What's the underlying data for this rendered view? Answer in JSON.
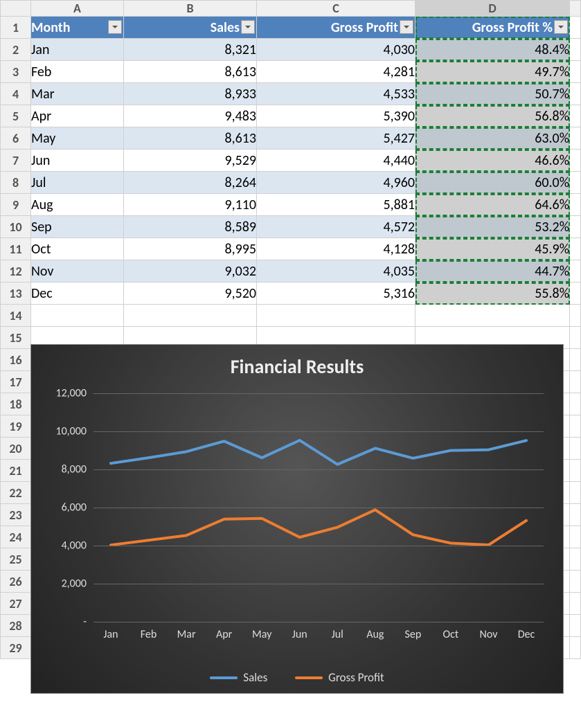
{
  "columns": [
    "A",
    "B",
    "C",
    "D"
  ],
  "headers": {
    "month": "Month",
    "sales": "Sales",
    "gross_profit": "Gross Profit",
    "gross_profit_pct": "Gross Profit %"
  },
  "rows": [
    {
      "n": 1,
      "month": "Jan",
      "sales": "8,321",
      "gp": "4,030",
      "gpp": "48.4%"
    },
    {
      "n": 2,
      "month": "Feb",
      "sales": "8,613",
      "gp": "4,281",
      "gpp": "49.7%"
    },
    {
      "n": 3,
      "month": "Mar",
      "sales": "8,933",
      "gp": "4,533",
      "gpp": "50.7%"
    },
    {
      "n": 4,
      "month": "Apr",
      "sales": "9,483",
      "gp": "5,390",
      "gpp": "56.8%"
    },
    {
      "n": 5,
      "month": "May",
      "sales": "8,613",
      "gp": "5,427",
      "gpp": "63.0%"
    },
    {
      "n": 6,
      "month": "Jun",
      "sales": "9,529",
      "gp": "4,440",
      "gpp": "46.6%"
    },
    {
      "n": 7,
      "month": "Jul",
      "sales": "8,264",
      "gp": "4,960",
      "gpp": "60.0%"
    },
    {
      "n": 8,
      "month": "Aug",
      "sales": "9,110",
      "gp": "5,881",
      "gpp": "64.6%"
    },
    {
      "n": 9,
      "month": "Sep",
      "sales": "8,589",
      "gp": "4,572",
      "gpp": "53.2%"
    },
    {
      "n": 10,
      "month": "Oct",
      "sales": "8,995",
      "gp": "4,128",
      "gpp": "45.9%"
    },
    {
      "n": 11,
      "month": "Nov",
      "sales": "9,032",
      "gp": "4,035",
      "gpp": "44.7%"
    },
    {
      "n": 12,
      "month": "Dec",
      "sales": "9,520",
      "gp": "5,316",
      "gpp": "55.8%"
    }
  ],
  "blank_rows_after": [
    14,
    15,
    16,
    17,
    18,
    19,
    20,
    21,
    22,
    23,
    24,
    25,
    26,
    27,
    28,
    29
  ],
  "chart_data": {
    "type": "line",
    "title": "Financial Results",
    "categories": [
      "Jan",
      "Feb",
      "Mar",
      "Apr",
      "May",
      "Jun",
      "Jul",
      "Aug",
      "Sep",
      "Oct",
      "Nov",
      "Dec"
    ],
    "series": [
      {
        "name": "Sales",
        "color": "#5B9BD5",
        "values": [
          8321,
          8613,
          8933,
          9483,
          8613,
          9529,
          8264,
          9110,
          8589,
          8995,
          9032,
          9520
        ]
      },
      {
        "name": "Gross Profit",
        "color": "#ED7D31",
        "values": [
          4030,
          4281,
          4533,
          5390,
          5427,
          4440,
          4960,
          5881,
          4572,
          4128,
          4035,
          5316
        ]
      }
    ],
    "ylim": [
      0,
      12000
    ],
    "yticks": [
      0,
      2000,
      4000,
      6000,
      8000,
      10000,
      12000
    ],
    "ytick_labels": [
      "-",
      "2,000",
      "4,000",
      "6,000",
      "8,000",
      "10,000",
      "12,000"
    ],
    "xlabel": "",
    "ylabel": ""
  },
  "legend": {
    "sales": "Sales",
    "gp": "Gross Profit"
  }
}
